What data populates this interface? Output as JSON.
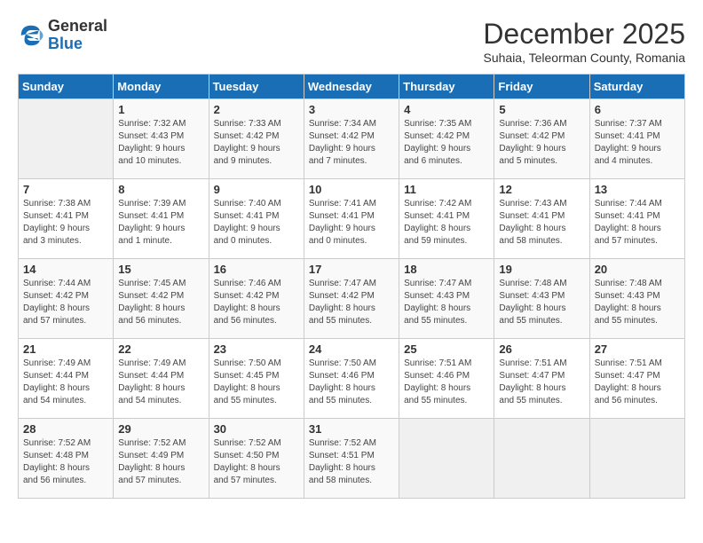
{
  "logo": {
    "general": "General",
    "blue": "Blue"
  },
  "title": "December 2025",
  "subtitle": "Suhaia, Teleorman County, Romania",
  "days_header": [
    "Sunday",
    "Monday",
    "Tuesday",
    "Wednesday",
    "Thursday",
    "Friday",
    "Saturday"
  ],
  "weeks": [
    [
      {
        "day": "",
        "info": ""
      },
      {
        "day": "1",
        "info": "Sunrise: 7:32 AM\nSunset: 4:43 PM\nDaylight: 9 hours\nand 10 minutes."
      },
      {
        "day": "2",
        "info": "Sunrise: 7:33 AM\nSunset: 4:42 PM\nDaylight: 9 hours\nand 9 minutes."
      },
      {
        "day": "3",
        "info": "Sunrise: 7:34 AM\nSunset: 4:42 PM\nDaylight: 9 hours\nand 7 minutes."
      },
      {
        "day": "4",
        "info": "Sunrise: 7:35 AM\nSunset: 4:42 PM\nDaylight: 9 hours\nand 6 minutes."
      },
      {
        "day": "5",
        "info": "Sunrise: 7:36 AM\nSunset: 4:42 PM\nDaylight: 9 hours\nand 5 minutes."
      },
      {
        "day": "6",
        "info": "Sunrise: 7:37 AM\nSunset: 4:41 PM\nDaylight: 9 hours\nand 4 minutes."
      }
    ],
    [
      {
        "day": "7",
        "info": "Sunrise: 7:38 AM\nSunset: 4:41 PM\nDaylight: 9 hours\nand 3 minutes."
      },
      {
        "day": "8",
        "info": "Sunrise: 7:39 AM\nSunset: 4:41 PM\nDaylight: 9 hours\nand 1 minute."
      },
      {
        "day": "9",
        "info": "Sunrise: 7:40 AM\nSunset: 4:41 PM\nDaylight: 9 hours\nand 0 minutes."
      },
      {
        "day": "10",
        "info": "Sunrise: 7:41 AM\nSunset: 4:41 PM\nDaylight: 9 hours\nand 0 minutes."
      },
      {
        "day": "11",
        "info": "Sunrise: 7:42 AM\nSunset: 4:41 PM\nDaylight: 8 hours\nand 59 minutes."
      },
      {
        "day": "12",
        "info": "Sunrise: 7:43 AM\nSunset: 4:41 PM\nDaylight: 8 hours\nand 58 minutes."
      },
      {
        "day": "13",
        "info": "Sunrise: 7:44 AM\nSunset: 4:41 PM\nDaylight: 8 hours\nand 57 minutes."
      }
    ],
    [
      {
        "day": "14",
        "info": "Sunrise: 7:44 AM\nSunset: 4:42 PM\nDaylight: 8 hours\nand 57 minutes."
      },
      {
        "day": "15",
        "info": "Sunrise: 7:45 AM\nSunset: 4:42 PM\nDaylight: 8 hours\nand 56 minutes."
      },
      {
        "day": "16",
        "info": "Sunrise: 7:46 AM\nSunset: 4:42 PM\nDaylight: 8 hours\nand 56 minutes."
      },
      {
        "day": "17",
        "info": "Sunrise: 7:47 AM\nSunset: 4:42 PM\nDaylight: 8 hours\nand 55 minutes."
      },
      {
        "day": "18",
        "info": "Sunrise: 7:47 AM\nSunset: 4:43 PM\nDaylight: 8 hours\nand 55 minutes."
      },
      {
        "day": "19",
        "info": "Sunrise: 7:48 AM\nSunset: 4:43 PM\nDaylight: 8 hours\nand 55 minutes."
      },
      {
        "day": "20",
        "info": "Sunrise: 7:48 AM\nSunset: 4:43 PM\nDaylight: 8 hours\nand 55 minutes."
      }
    ],
    [
      {
        "day": "21",
        "info": "Sunrise: 7:49 AM\nSunset: 4:44 PM\nDaylight: 8 hours\nand 54 minutes."
      },
      {
        "day": "22",
        "info": "Sunrise: 7:49 AM\nSunset: 4:44 PM\nDaylight: 8 hours\nand 54 minutes."
      },
      {
        "day": "23",
        "info": "Sunrise: 7:50 AM\nSunset: 4:45 PM\nDaylight: 8 hours\nand 55 minutes."
      },
      {
        "day": "24",
        "info": "Sunrise: 7:50 AM\nSunset: 4:46 PM\nDaylight: 8 hours\nand 55 minutes."
      },
      {
        "day": "25",
        "info": "Sunrise: 7:51 AM\nSunset: 4:46 PM\nDaylight: 8 hours\nand 55 minutes."
      },
      {
        "day": "26",
        "info": "Sunrise: 7:51 AM\nSunset: 4:47 PM\nDaylight: 8 hours\nand 55 minutes."
      },
      {
        "day": "27",
        "info": "Sunrise: 7:51 AM\nSunset: 4:47 PM\nDaylight: 8 hours\nand 56 minutes."
      }
    ],
    [
      {
        "day": "28",
        "info": "Sunrise: 7:52 AM\nSunset: 4:48 PM\nDaylight: 8 hours\nand 56 minutes."
      },
      {
        "day": "29",
        "info": "Sunrise: 7:52 AM\nSunset: 4:49 PM\nDaylight: 8 hours\nand 57 minutes."
      },
      {
        "day": "30",
        "info": "Sunrise: 7:52 AM\nSunset: 4:50 PM\nDaylight: 8 hours\nand 57 minutes."
      },
      {
        "day": "31",
        "info": "Sunrise: 7:52 AM\nSunset: 4:51 PM\nDaylight: 8 hours\nand 58 minutes."
      },
      {
        "day": "",
        "info": ""
      },
      {
        "day": "",
        "info": ""
      },
      {
        "day": "",
        "info": ""
      }
    ]
  ]
}
